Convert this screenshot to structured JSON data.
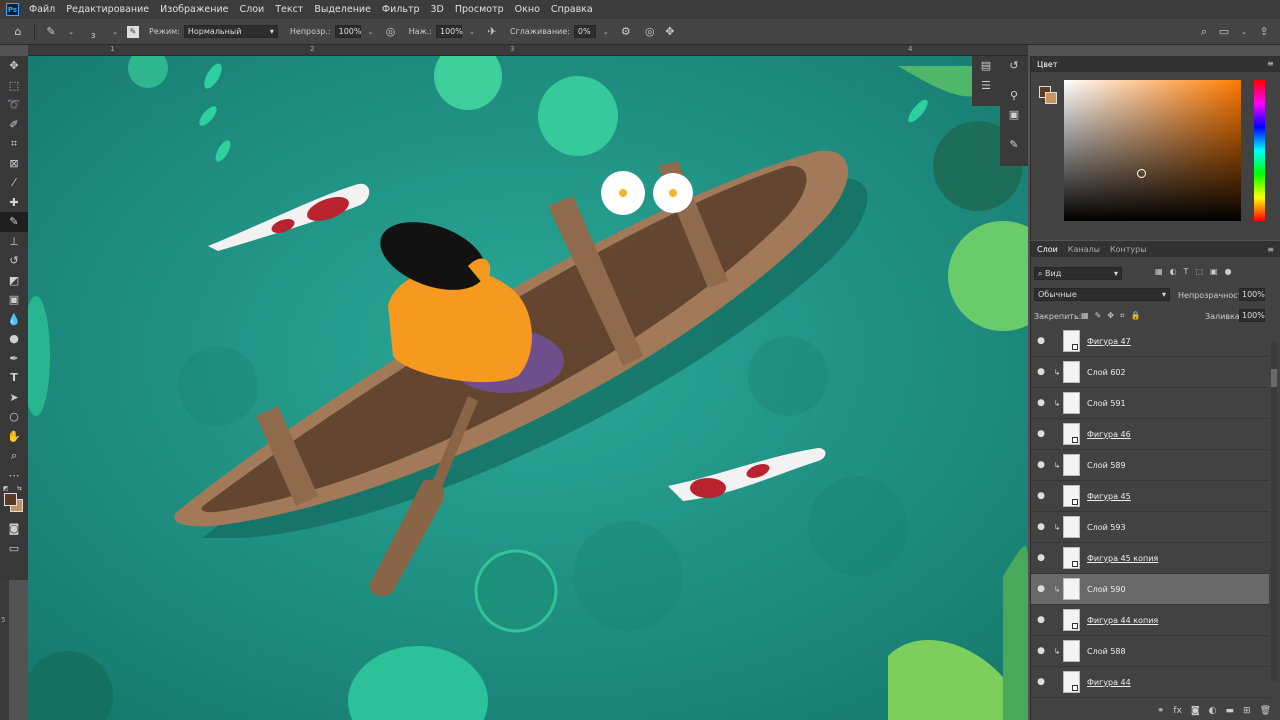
{
  "app": {
    "logo": "Ps"
  },
  "menu": [
    "Файл",
    "Редактирование",
    "Изображение",
    "Слои",
    "Текст",
    "Выделение",
    "Фильтр",
    "3D",
    "Просмотр",
    "Окно",
    "Справка"
  ],
  "options": {
    "brush_size": "3",
    "mode_label": "Режим:",
    "mode_value": "Нормальный",
    "opacity_label": "Непрозр.:",
    "opacity_value": "100%",
    "flow_label": "Наж.:",
    "flow_value": "100%",
    "smoothing_label": "Сглаживание:",
    "smoothing_value": "0%"
  },
  "rulers": {
    "top": [
      "1",
      "2",
      "3",
      "4"
    ],
    "left": [
      "5"
    ]
  },
  "color_panel": {
    "tab": "Цвет",
    "fg": "#5a3a22",
    "bg": "#c9935f"
  },
  "layers_panel": {
    "tabs": [
      "Слои",
      "Каналы",
      "Контуры"
    ],
    "filter_label": "Вид",
    "blend_mode": "Обычные",
    "opacity_label": "Непрозрачность:",
    "opacity_value": "100%",
    "lock_label": "Закрепить:",
    "fill_label": "Заливка:",
    "fill_value": "100%",
    "layers": [
      {
        "name": "Фигура 47",
        "type": "shape",
        "clipped": false,
        "selected": false
      },
      {
        "name": "Слой 602",
        "type": "pixel",
        "clipped": true,
        "selected": false
      },
      {
        "name": "Слой 591",
        "type": "pixel",
        "clipped": true,
        "selected": false
      },
      {
        "name": "Фигура 46",
        "type": "shape",
        "clipped": false,
        "selected": false
      },
      {
        "name": "Слой 589",
        "type": "pixel",
        "clipped": true,
        "selected": false
      },
      {
        "name": "Фигура 45",
        "type": "shape",
        "clipped": false,
        "selected": false
      },
      {
        "name": "Слой 593",
        "type": "pixel",
        "clipped": true,
        "selected": false
      },
      {
        "name": "Фигура 45 копия",
        "type": "shape",
        "clipped": false,
        "selected": false
      },
      {
        "name": "Слой 590",
        "type": "pixel",
        "clipped": true,
        "selected": true
      },
      {
        "name": "Фигура 44 копия",
        "type": "shape",
        "clipped": false,
        "selected": false
      },
      {
        "name": "Слой 588",
        "type": "pixel",
        "clipped": true,
        "selected": false
      },
      {
        "name": "Фигура 44",
        "type": "shape",
        "clipped": false,
        "selected": false
      }
    ]
  },
  "colors": {
    "water": "#1f9a8a",
    "boat": "#8a6447",
    "shirt": "#f59a1f",
    "fish_red": "#b8232f"
  }
}
